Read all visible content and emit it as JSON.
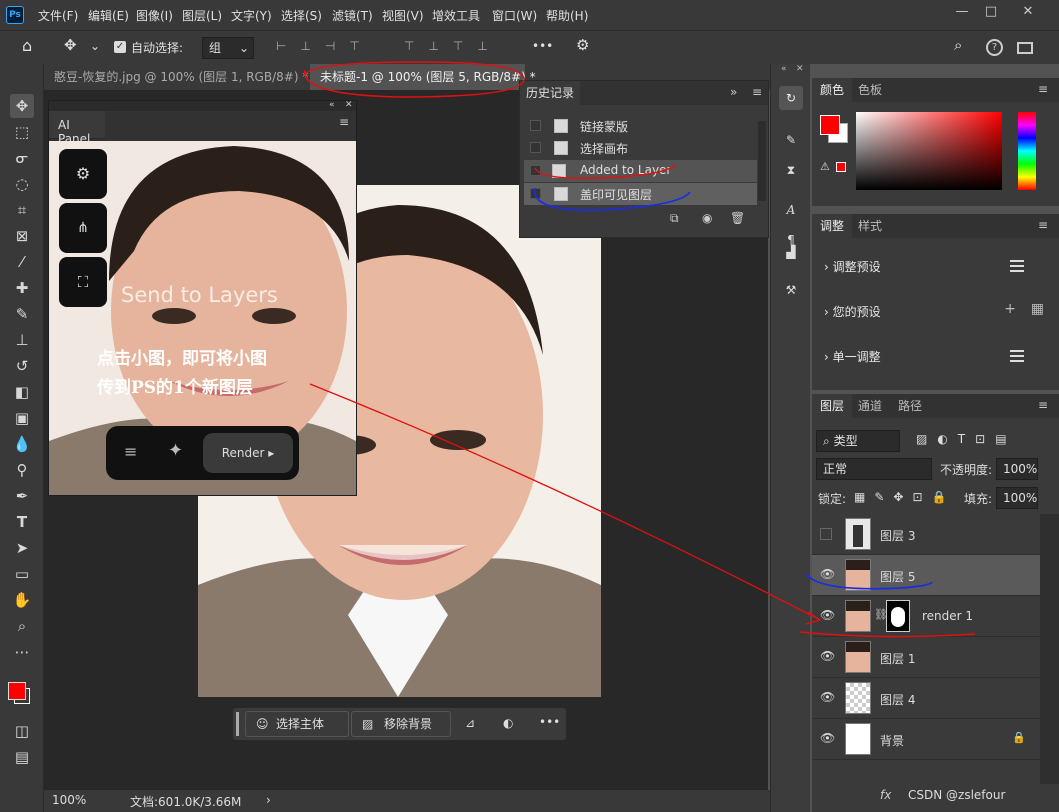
{
  "app": {
    "logo_text": "Ps",
    "menus": [
      "文件(F)",
      "编辑(E)",
      "图像(I)",
      "图层(L)",
      "文字(Y)",
      "选择(S)",
      "滤镜(T)",
      "视图(V)",
      "增效工具",
      "窗口(W)",
      "帮助(H)"
    ],
    "window_controls": [
      "—",
      "□",
      "✕"
    ]
  },
  "options": {
    "auto_select_label": "自动选择:",
    "auto_select_value": "组",
    "more": "•••"
  },
  "tabs": [
    {
      "label": "憨豆-恢复的.jpg @ 100% (图层 1, RGB/8#) *",
      "close": "✕"
    },
    {
      "label": "未标题-1 @ 100% (图层 5, RGB/8#) *",
      "close": "✕"
    }
  ],
  "ai_panel": {
    "title": "AI Panel",
    "overlay_text": "Send to Layers",
    "annotation_line1": "点击小图，即可将小图",
    "annotation_line2": "传到PS的1个新图层",
    "render_label": "Render"
  },
  "history": {
    "title": "历史记录",
    "items": [
      "链接蒙版",
      "选择画布",
      "Added to Layer",
      "盖印可见图层"
    ]
  },
  "context_bar": {
    "select_subject": "选择主体",
    "remove_bg": "移除背景"
  },
  "status": {
    "zoom": "100%",
    "doc": "文档:601.0K/3.66M"
  },
  "color_panel": {
    "tabs": [
      "颜色",
      "色板"
    ],
    "foreground": "#ff0000",
    "background": "#ffffff"
  },
  "adjust_panel": {
    "tabs": [
      "调整",
      "样式"
    ],
    "items": [
      "调整预设",
      "您的预设",
      "单一调整"
    ]
  },
  "layers_panel": {
    "tabs": [
      "图层",
      "通道",
      "路径"
    ],
    "filter": "类型",
    "blend": "正常",
    "opacity_label": "不透明度:",
    "opacity": "100%",
    "lock_label": "锁定:",
    "fill_label": "填充:",
    "fill": "100%",
    "layers": [
      {
        "name": "图层 3",
        "visible": false
      },
      {
        "name": "图层 5",
        "visible": true,
        "selected": true
      },
      {
        "name": "render 1",
        "visible": true
      },
      {
        "name": "图层 1",
        "visible": true
      },
      {
        "name": "图层 4",
        "visible": true
      },
      {
        "name": "背景",
        "visible": true,
        "locked": true
      }
    ],
    "footer_fx": "fx"
  },
  "watermark": "CSDN @zslefour"
}
